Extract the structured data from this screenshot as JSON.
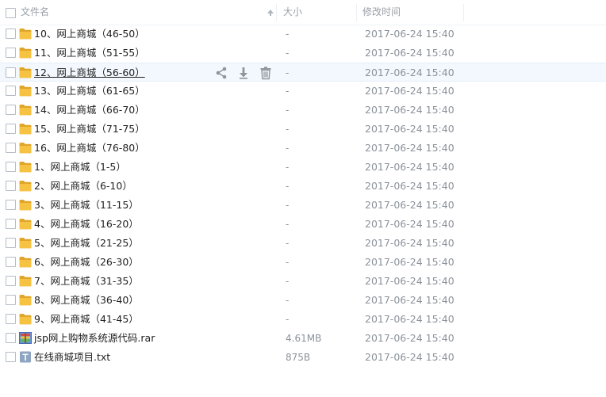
{
  "header": {
    "name_label": "文件名",
    "size_label": "大小",
    "modified_label": "修改时间",
    "sort_indicator": "arrow-up-icon"
  },
  "files": [
    {
      "name": "10、网上商城（46-50）",
      "size": "-",
      "date": "2017-06-24 15:40",
      "type": "folder"
    },
    {
      "name": "11、网上商城（51-55）",
      "size": "-",
      "date": "2017-06-24 15:40",
      "type": "folder"
    },
    {
      "name": "12、网上商城（56-60）",
      "size": "-",
      "date": "2017-06-24 15:40",
      "type": "folder",
      "hovered": true
    },
    {
      "name": "13、网上商城（61-65）",
      "size": "-",
      "date": "2017-06-24 15:40",
      "type": "folder"
    },
    {
      "name": "14、网上商城（66-70）",
      "size": "-",
      "date": "2017-06-24 15:40",
      "type": "folder"
    },
    {
      "name": "15、网上商城（71-75）",
      "size": "-",
      "date": "2017-06-24 15:40",
      "type": "folder"
    },
    {
      "name": "16、网上商城（76-80）",
      "size": "-",
      "date": "2017-06-24 15:40",
      "type": "folder"
    },
    {
      "name": "1、网上商城（1-5）",
      "size": "-",
      "date": "2017-06-24 15:40",
      "type": "folder"
    },
    {
      "name": "2、网上商城（6-10）",
      "size": "-",
      "date": "2017-06-24 15:40",
      "type": "folder"
    },
    {
      "name": "3、网上商城（11-15）",
      "size": "-",
      "date": "2017-06-24 15:40",
      "type": "folder"
    },
    {
      "name": "4、网上商城（16-20）",
      "size": "-",
      "date": "2017-06-24 15:40",
      "type": "folder"
    },
    {
      "name": "5、网上商城（21-25）",
      "size": "-",
      "date": "2017-06-24 15:40",
      "type": "folder"
    },
    {
      "name": "6、网上商城（26-30）",
      "size": "-",
      "date": "2017-06-24 15:40",
      "type": "folder"
    },
    {
      "name": "7、网上商城（31-35）",
      "size": "-",
      "date": "2017-06-24 15:40",
      "type": "folder"
    },
    {
      "name": "8、网上商城（36-40）",
      "size": "-",
      "date": "2017-06-24 15:40",
      "type": "folder"
    },
    {
      "name": "9、网上商城（41-45）",
      "size": "-",
      "date": "2017-06-24 15:40",
      "type": "folder"
    },
    {
      "name": "jsp网上购物系统源代码.rar",
      "size": "4.61MB",
      "date": "2017-06-24 15:40",
      "type": "rar"
    },
    {
      "name": "在线商城项目.txt",
      "size": "875B",
      "date": "2017-06-24 15:40",
      "type": "txt"
    }
  ],
  "row_actions": [
    "share-icon",
    "download-icon",
    "delete-icon"
  ],
  "colors": {
    "folder": "#f5c242",
    "folder_dark": "#e0a52a",
    "hover_bg": "#f2f8fd",
    "icon_gray": "#8e959e"
  }
}
